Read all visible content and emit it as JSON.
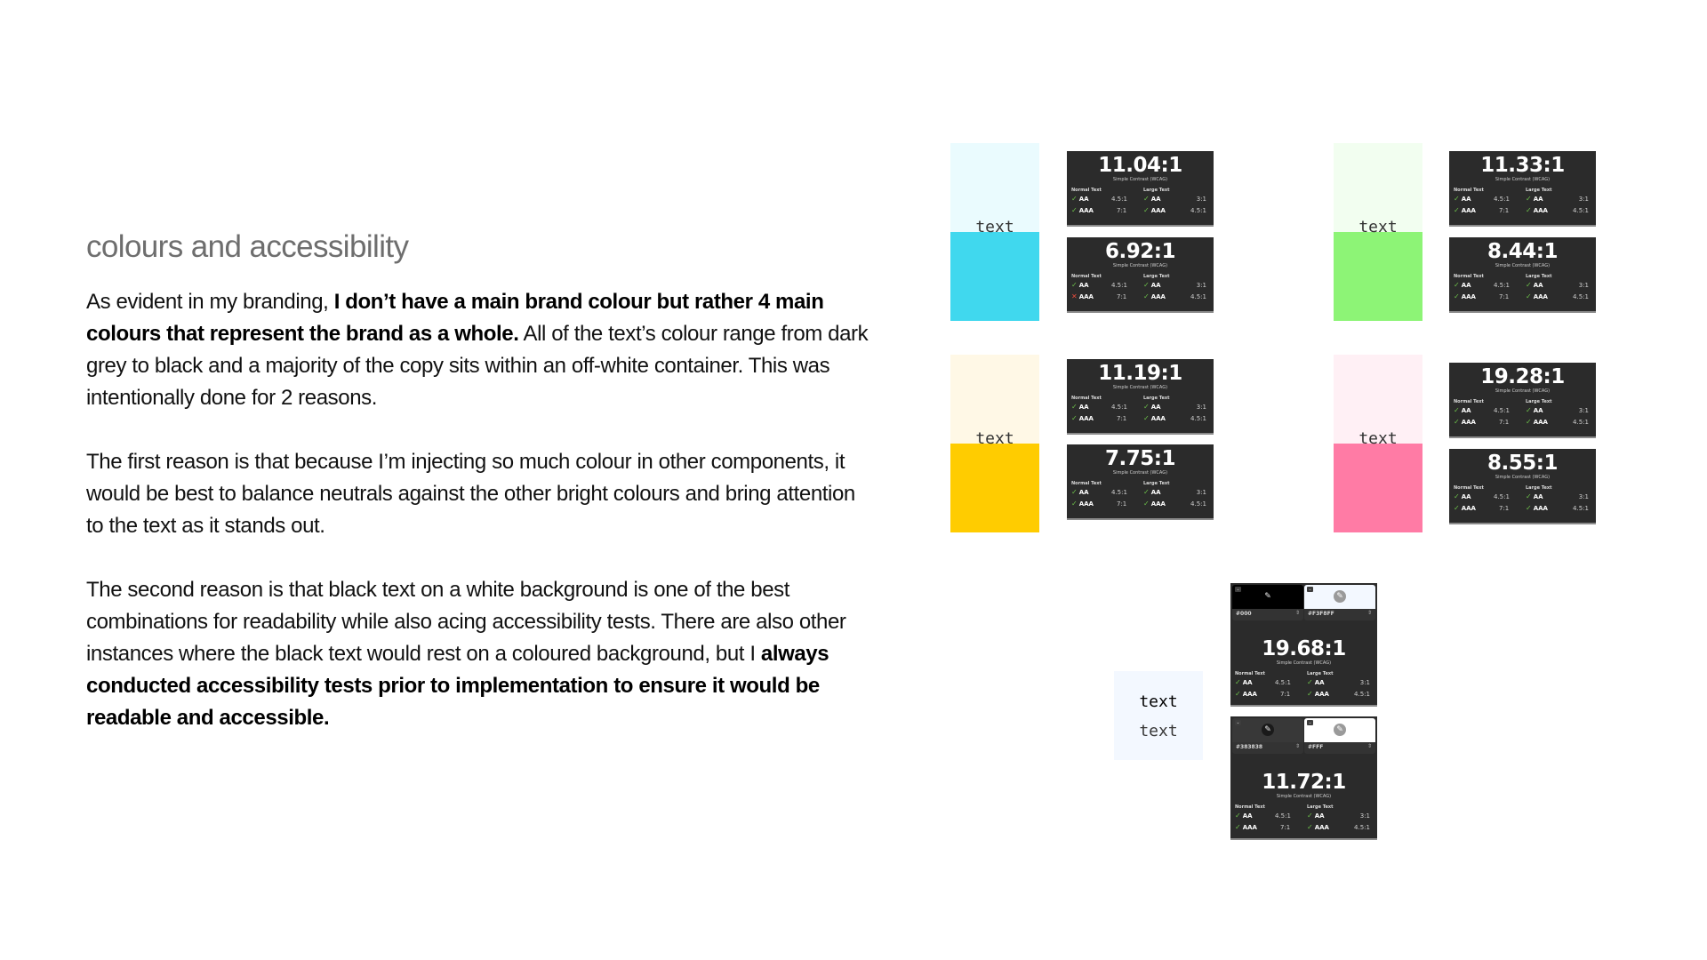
{
  "heading": "colours and accessibility",
  "paragraphs": {
    "p1": {
      "a": "As evident in my branding, ",
      "b": "I don’t have a main brand colour but rather 4 main colours that represent the brand as a whole.",
      "c": " All of the text’s colour range from dark grey to black and a majority of the copy sits within an off-white container. This was intentionally done for 2 reasons."
    },
    "p2": "The first reason is that because I’m injecting so much colour in other components, it would be best to balance neutrals against the other bright colours and bring attention to the text as it stands out.",
    "p3": {
      "a": "The second reason is that black text on a white background is one of the best combinations for readability while also acing accessibility tests. There are also other instances where the black text would rest on a coloured background, but I ",
      "b": "always conducted accessibility tests prior to implementation to ensure it would be readable and accessible."
    }
  },
  "common": {
    "subtitle": "Simple Contrast (WCAG)",
    "normal_text": "Normal Text",
    "large_text": "Large Text",
    "aa": "AA",
    "aaa": "AAA",
    "aa_normal_req": "4.5:1",
    "aaa_normal_req": "7:1",
    "aa_large_req": "3:1",
    "aaa_large_req": "4.5:1",
    "swatch_label": "text"
  },
  "swatches": [
    {
      "name": "cyan",
      "light": "#EAFBFE",
      "dark": "#40D8EE",
      "cards": [
        {
          "ratio": "11.04:1",
          "aa_normal": true,
          "aaa_normal": true,
          "aa_large": true,
          "aaa_large": true
        },
        {
          "ratio": "6.92:1",
          "aa_normal": true,
          "aaa_normal": false,
          "aa_large": true,
          "aaa_large": true
        }
      ]
    },
    {
      "name": "green",
      "light": "#F2FEF0",
      "dark": "#8DF476",
      "cards": [
        {
          "ratio": "11.33:1",
          "aa_normal": true,
          "aaa_normal": true,
          "aa_large": true,
          "aaa_large": true
        },
        {
          "ratio": "8.44:1",
          "aa_normal": true,
          "aaa_normal": true,
          "aa_large": true,
          "aaa_large": true
        }
      ]
    },
    {
      "name": "yellow",
      "light": "#FFF8E6",
      "dark": "#FFCC00",
      "cards": [
        {
          "ratio": "11.19:1",
          "aa_normal": true,
          "aaa_normal": true,
          "aa_large": true,
          "aaa_large": true
        },
        {
          "ratio": "7.75:1",
          "aa_normal": true,
          "aaa_normal": true,
          "aa_large": true,
          "aaa_large": true
        }
      ]
    },
    {
      "name": "pink",
      "light": "#FFF0F5",
      "dark": "#FF7BA5",
      "cards": [
        {
          "ratio": "19.28:1",
          "aa_normal": true,
          "aaa_normal": true,
          "aa_large": true,
          "aaa_large": true
        },
        {
          "ratio": "8.55:1",
          "aa_normal": true,
          "aaa_normal": true,
          "aa_large": true,
          "aaa_large": true
        }
      ]
    }
  ],
  "sample": {
    "background": "#F3F8FF",
    "text1": "text",
    "text2": "text"
  },
  "pickers": [
    {
      "fg_hex": "#000",
      "fg_color": "#000000",
      "bg_hex": "#F3F8FF",
      "bg_color": "#F3F8FF",
      "ratio": "19.68:1"
    },
    {
      "fg_hex": "#383838",
      "fg_color": "#383838",
      "bg_hex": "#FFF",
      "bg_color": "#FFFFFF",
      "ratio": "11.72:1"
    }
  ],
  "colors": {
    "card_bg": "#2B2B2B",
    "pass": "#6CC04A",
    "fail": "#E74C3C",
    "heading": "#6E6E6E"
  }
}
